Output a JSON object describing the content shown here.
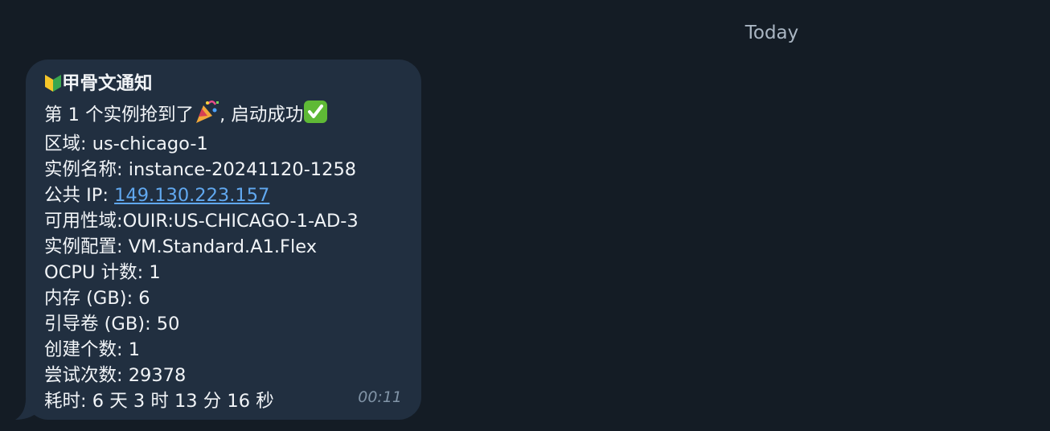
{
  "date_separator": "Today",
  "message": {
    "title": "甲骨文通知",
    "title_icon": "japanese-beginner-symbol-icon",
    "success_prefix": "第 1 个实例抢到了",
    "party_icon": "party-popper-icon",
    "success_suffix": ", 启动成功",
    "check_icon": "check-mark-icon",
    "region": "区域: us-chicago-1",
    "instance_name": "实例名称: instance-20241120-1258",
    "public_ip_label": "公共 IP: ",
    "public_ip": "149.130.223.157",
    "availability_domain": "可用性域:OUIR:US-CHICAGO-1-AD-3",
    "shape": "实例配置: VM.Standard.A1.Flex",
    "ocpu": "OCPU 计数: 1",
    "memory": "内存 (GB): 6",
    "boot_volume": "引导卷 (GB): 50",
    "created_count": "创建个数: 1",
    "attempts": "尝试次数: 29378",
    "elapsed": "耗时: 6 天 3 时 13 分 16 秒",
    "time": "00:11"
  },
  "colors": {
    "background": "#141c25",
    "bubble": "#212f40",
    "link": "#61a8ef",
    "text": "#f1f4f7",
    "timestamp": "#8194a7"
  }
}
